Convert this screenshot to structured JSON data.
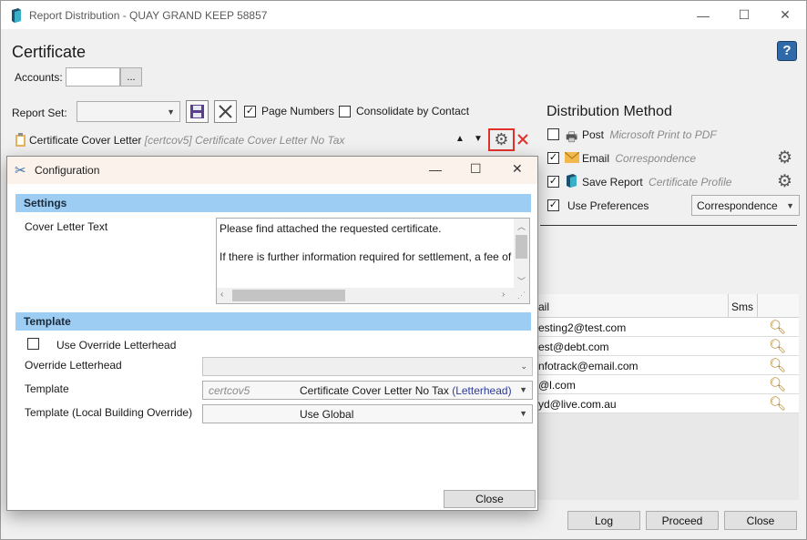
{
  "window": {
    "title": "Report Distribution - QUAY GRAND KEEP 58857",
    "minimize": "—",
    "maximize": "☐",
    "close": "✕"
  },
  "certificate": {
    "heading": "Certificate",
    "help_label": "?",
    "accounts_label": "Accounts:",
    "accounts_value": "",
    "accounts_browse": "...",
    "report_set_label": "Report Set:",
    "report_set_value": "",
    "page_numbers_label": "Page Numbers",
    "page_numbers_checked": true,
    "consolidate_label": "Consolidate by Contact",
    "consolidate_checked": false
  },
  "report_row": {
    "name": "Certificate Cover Letter",
    "code": "[certcov5]",
    "description": "Certificate Cover Letter No Tax"
  },
  "distribution": {
    "heading": "Distribution Method",
    "methods": [
      {
        "label": "Post",
        "detail": "Microsoft Print to PDF",
        "checked": false
      },
      {
        "label": "Email",
        "detail": "Correspondence",
        "checked": true
      },
      {
        "label": "Save Report",
        "detail": "Certificate Profile",
        "checked": true
      }
    ],
    "use_preferences_label": "Use Preferences",
    "use_preferences_checked": true,
    "preferences_value": "Correspondence"
  },
  "recipients": {
    "columns": [
      "ail",
      "Sms"
    ],
    "rows": [
      "esting2@test.com",
      "est@debt.com",
      "nfotrack@email.com",
      "@l.com",
      "yd@live.com.au"
    ]
  },
  "footer": {
    "log": "Log",
    "proceed": "Proceed",
    "close": "Close"
  },
  "dialog": {
    "title": "Configuration",
    "settings_heading": "Settings",
    "cover_letter_label": "Cover Letter Text",
    "cover_letter_line1": "Please find attached the requested certificate.",
    "cover_letter_line2": "If there is further information required for settlement, a fee of",
    "template_heading": "Template",
    "use_override_label": "Use Override Letterhead",
    "use_override_checked": false,
    "override_letterhead_label": "Override Letterhead",
    "override_letterhead_value": "",
    "template_label": "Template",
    "template_code": "certcov5",
    "template_name": "Certificate Cover Letter No Tax",
    "template_suffix": "(Letterhead)",
    "local_override_label": "Template (Local Building Override)",
    "local_override_value": "Use Global",
    "close_button": "Close"
  },
  "colors": {
    "section_bar": "#9dcdf2",
    "dialog_titlebar": "#fbf2ec",
    "highlight_red": "#e0322b",
    "help_blue": "#2e6aa9",
    "letterhead_blue": "#2b3a9c"
  }
}
